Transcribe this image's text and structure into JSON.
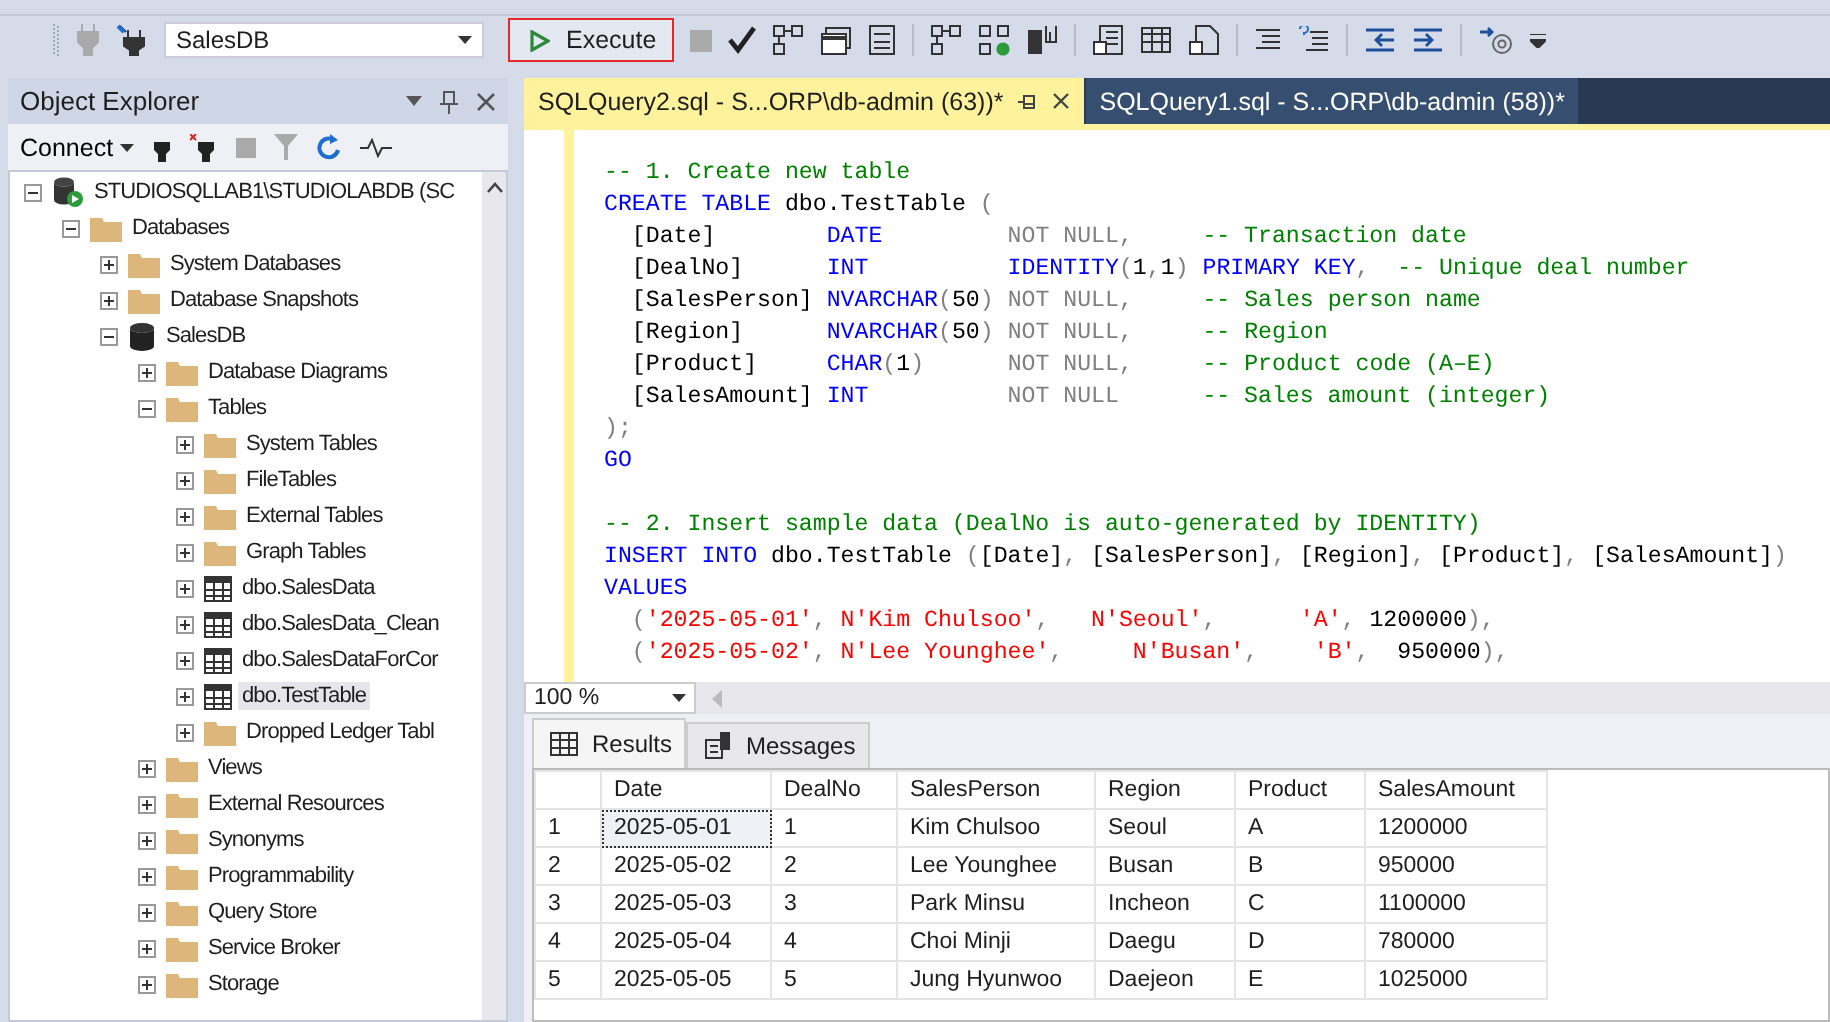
{
  "toolbar": {
    "database": "SalesDB",
    "execute_label": "Execute"
  },
  "object_explorer": {
    "title": "Object Explorer",
    "connect_label": "Connect",
    "tree": [
      {
        "label": "STUDIOSQLLAB1\\STUDIOLABDB (SC",
        "kind": "server",
        "expanded": true,
        "selected": false,
        "children": [
          {
            "label": "Databases",
            "kind": "folder",
            "expanded": true,
            "selected": false,
            "children": [
              {
                "label": "System Databases",
                "kind": "folder",
                "expanded": false,
                "selected": false
              },
              {
                "label": "Database Snapshots",
                "kind": "folder",
                "expanded": false,
                "selected": false
              },
              {
                "label": "SalesDB",
                "kind": "database",
                "expanded": true,
                "selected": false,
                "children": [
                  {
                    "label": "Database Diagrams",
                    "kind": "folder",
                    "expanded": false,
                    "selected": false
                  },
                  {
                    "label": "Tables",
                    "kind": "folder",
                    "expanded": true,
                    "selected": false,
                    "children": [
                      {
                        "label": "System Tables",
                        "kind": "folder",
                        "expanded": false,
                        "selected": false
                      },
                      {
                        "label": "FileTables",
                        "kind": "folder",
                        "expanded": false,
                        "selected": false
                      },
                      {
                        "label": "External Tables",
                        "kind": "folder",
                        "expanded": false,
                        "selected": false
                      },
                      {
                        "label": "Graph Tables",
                        "kind": "folder",
                        "expanded": false,
                        "selected": false
                      },
                      {
                        "label": "dbo.SalesData",
                        "kind": "table",
                        "expanded": false,
                        "selected": false
                      },
                      {
                        "label": "dbo.SalesData_Clean",
                        "kind": "table",
                        "expanded": false,
                        "selected": false
                      },
                      {
                        "label": "dbo.SalesDataForCor",
                        "kind": "table",
                        "expanded": false,
                        "selected": false
                      },
                      {
                        "label": "dbo.TestTable",
                        "kind": "table",
                        "expanded": false,
                        "selected": true
                      },
                      {
                        "label": "Dropped Ledger Tabl",
                        "kind": "folder",
                        "expanded": false,
                        "selected": false
                      }
                    ]
                  },
                  {
                    "label": "Views",
                    "kind": "folder",
                    "expanded": false,
                    "selected": false
                  },
                  {
                    "label": "External Resources",
                    "kind": "folder",
                    "expanded": false,
                    "selected": false
                  },
                  {
                    "label": "Synonyms",
                    "kind": "folder",
                    "expanded": false,
                    "selected": false
                  },
                  {
                    "label": "Programmability",
                    "kind": "folder",
                    "expanded": false,
                    "selected": false
                  },
                  {
                    "label": "Query Store",
                    "kind": "folder",
                    "expanded": false,
                    "selected": false
                  },
                  {
                    "label": "Service Broker",
                    "kind": "folder",
                    "expanded": false,
                    "selected": false
                  },
                  {
                    "label": "Storage",
                    "kind": "folder",
                    "expanded": false,
                    "selected": false
                  }
                ]
              }
            ]
          }
        ]
      }
    ]
  },
  "editor": {
    "tabs": [
      {
        "label": "SQLQuery2.sql - S...ORP\\db-admin (63))*",
        "selected": true
      },
      {
        "label": "SQLQuery1.sql - S...ORP\\db-admin (58))*",
        "selected": false
      }
    ],
    "code": [
      {
        "space_before": false,
        "tokens": [
          {
            "kind": "comment",
            "text": "-- 1. Create new table"
          }
        ]
      },
      {
        "space_before": false,
        "tokens": [
          {
            "kind": "keyword",
            "text": "CREATE TABLE"
          },
          {
            "kind": "text",
            "text": " dbo.TestTable "
          },
          {
            "kind": "punct",
            "text": "("
          }
        ]
      },
      {
        "space_before": false,
        "tokens": [
          {
            "kind": "text",
            "text": "  [Date]        "
          },
          {
            "kind": "keyword",
            "text": "DATE         "
          },
          {
            "kind": "punct",
            "text": "NOT NULL,     "
          },
          {
            "kind": "comment",
            "text": "-- Transaction date"
          }
        ]
      },
      {
        "space_before": false,
        "tokens": [
          {
            "kind": "text",
            "text": "  [DealNo]      "
          },
          {
            "kind": "keyword",
            "text": "INT          "
          },
          {
            "kind": "keyword",
            "text": "IDENTITY"
          },
          {
            "kind": "punct",
            "text": "("
          },
          {
            "kind": "text",
            "text": "1"
          },
          {
            "kind": "punct",
            "text": ","
          },
          {
            "kind": "text",
            "text": "1"
          },
          {
            "kind": "punct",
            "text": ") "
          },
          {
            "kind": "keyword",
            "text": "PRIMARY KEY"
          },
          {
            "kind": "punct",
            "text": ",  "
          },
          {
            "kind": "comment",
            "text": "-- Unique deal number"
          }
        ]
      },
      {
        "space_before": false,
        "tokens": [
          {
            "kind": "text",
            "text": "  [SalesPerson] "
          },
          {
            "kind": "keyword",
            "text": "NVARCHAR"
          },
          {
            "kind": "punct",
            "text": "("
          },
          {
            "kind": "text",
            "text": "50"
          },
          {
            "kind": "punct",
            "text": ") "
          },
          {
            "kind": "punct",
            "text": "NOT NULL,     "
          },
          {
            "kind": "comment",
            "text": "-- Sales person name"
          }
        ]
      },
      {
        "space_before": false,
        "tokens": [
          {
            "kind": "text",
            "text": "  [Region]      "
          },
          {
            "kind": "keyword",
            "text": "NVARCHAR"
          },
          {
            "kind": "punct",
            "text": "("
          },
          {
            "kind": "text",
            "text": "50"
          },
          {
            "kind": "punct",
            "text": ") "
          },
          {
            "kind": "punct",
            "text": "NOT NULL,     "
          },
          {
            "kind": "comment",
            "text": "-- Region"
          }
        ]
      },
      {
        "space_before": false,
        "tokens": [
          {
            "kind": "text",
            "text": "  [Product]     "
          },
          {
            "kind": "keyword",
            "text": "CHAR"
          },
          {
            "kind": "punct",
            "text": "("
          },
          {
            "kind": "text",
            "text": "1"
          },
          {
            "kind": "punct",
            "text": ")      "
          },
          {
            "kind": "punct",
            "text": "NOT NULL,     "
          },
          {
            "kind": "comment",
            "text": "-- Product code (A–E)"
          }
        ]
      },
      {
        "space_before": false,
        "tokens": [
          {
            "kind": "text",
            "text": "  [SalesAmount] "
          },
          {
            "kind": "keyword",
            "text": "INT          "
          },
          {
            "kind": "punct",
            "text": "NOT NULL      "
          },
          {
            "kind": "comment",
            "text": "-- Sales amount (integer)"
          }
        ]
      },
      {
        "space_before": false,
        "tokens": [
          {
            "kind": "punct",
            "text": ");"
          }
        ]
      },
      {
        "space_before": false,
        "tokens": [
          {
            "kind": "keyword",
            "text": "GO"
          }
        ]
      },
      {
        "space_before": true,
        "tokens": [
          {
            "kind": "comment",
            "text": "-- 2. Insert sample data (DealNo is auto-generated by IDENTITY)"
          }
        ]
      },
      {
        "space_before": false,
        "tokens": [
          {
            "kind": "keyword",
            "text": "INSERT INTO"
          },
          {
            "kind": "text",
            "text": " dbo.TestTable "
          },
          {
            "kind": "punct",
            "text": "("
          },
          {
            "kind": "text",
            "text": "[Date]"
          },
          {
            "kind": "punct",
            "text": ", "
          },
          {
            "kind": "text",
            "text": "[SalesPerson]"
          },
          {
            "kind": "punct",
            "text": ", "
          },
          {
            "kind": "text",
            "text": "[Region]"
          },
          {
            "kind": "punct",
            "text": ", "
          },
          {
            "kind": "text",
            "text": "[Product]"
          },
          {
            "kind": "punct",
            "text": ", "
          },
          {
            "kind": "text",
            "text": "[SalesAmount]"
          },
          {
            "kind": "punct",
            "text": ")"
          }
        ]
      },
      {
        "space_before": false,
        "tokens": [
          {
            "kind": "keyword",
            "text": "VALUES"
          }
        ]
      },
      {
        "space_before": false,
        "tokens": [
          {
            "kind": "punct",
            "text": "  ("
          },
          {
            "kind": "string",
            "text": "'2025-05-01'"
          },
          {
            "kind": "punct",
            "text": ", "
          },
          {
            "kind": "string",
            "text": "N'Kim Chulsoo'"
          },
          {
            "kind": "punct",
            "text": ",   "
          },
          {
            "kind": "string",
            "text": "N'Seoul'"
          },
          {
            "kind": "punct",
            "text": ",      "
          },
          {
            "kind": "string",
            "text": "'A'"
          },
          {
            "kind": "punct",
            "text": ", "
          },
          {
            "kind": "text",
            "text": "1200000"
          },
          {
            "kind": "punct",
            "text": "),"
          }
        ]
      },
      {
        "space_before": false,
        "tokens": [
          {
            "kind": "punct",
            "text": "  ("
          },
          {
            "kind": "string",
            "text": "'2025-05-02'"
          },
          {
            "kind": "punct",
            "text": ", "
          },
          {
            "kind": "string",
            "text": "N'Lee Younghee'"
          },
          {
            "kind": "punct",
            "text": ",     "
          },
          {
            "kind": "string",
            "text": "N'Busan'"
          },
          {
            "kind": "punct",
            "text": ",    "
          },
          {
            "kind": "string",
            "text": "'B'"
          },
          {
            "kind": "punct",
            "text": ",  "
          },
          {
            "kind": "text",
            "text": "950000"
          },
          {
            "kind": "punct",
            "text": "),"
          }
        ]
      }
    ],
    "zoom": "100 %"
  },
  "results": {
    "tabs": [
      {
        "label": "Results",
        "kind": "grid",
        "selected": true
      },
      {
        "label": "Messages",
        "kind": "messages",
        "selected": false
      }
    ],
    "columns": [
      "Date",
      "DealNo",
      "SalesPerson",
      "Region",
      "Product",
      "SalesAmount"
    ],
    "rows": [
      {
        "number": "1",
        "cells": [
          "2025-05-01",
          "1",
          "Kim Chulsoo",
          "Seoul",
          "A",
          "1200000"
        ]
      },
      {
        "number": "2",
        "cells": [
          "2025-05-02",
          "2",
          "Lee Younghee",
          "Busan",
          "B",
          "950000"
        ]
      },
      {
        "number": "3",
        "cells": [
          "2025-05-03",
          "3",
          "Park Minsu",
          "Incheon",
          "C",
          "1100000"
        ]
      },
      {
        "number": "4",
        "cells": [
          "2025-05-04",
          "4",
          "Choi Minji",
          "Daegu",
          "D",
          "780000"
        ]
      },
      {
        "number": "5",
        "cells": [
          "2025-05-05",
          "5",
          "Jung Hyunwoo",
          "Daejeon",
          "E",
          "1025000"
        ]
      }
    ]
  }
}
